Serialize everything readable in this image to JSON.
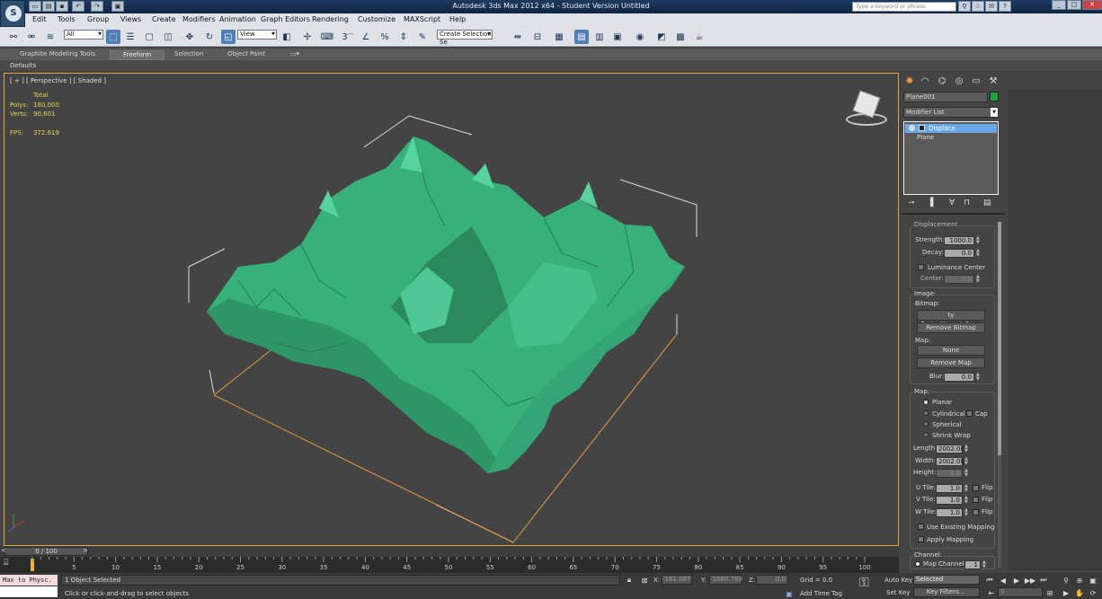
{
  "window": {
    "title": "Autodesk 3ds Max  2012 x64    -  Student Version   Untitled",
    "search_placeholder": "Type a keyword or phrase"
  },
  "menu": [
    "Edit",
    "Tools",
    "Group",
    "Views",
    "Create",
    "Modifiers",
    "Animation",
    "Graph Editors",
    "Rendering",
    "Customize",
    "MAXScript",
    "Help"
  ],
  "toolbar": {
    "selection_filter": "All",
    "ref_coord": "View",
    "named_selection": "Create Selection Se",
    "snap_label": "3"
  },
  "ribbon": {
    "tabs": [
      "Graphite Modeling Tools",
      "Freeform",
      "Selection",
      "Object Paint"
    ],
    "active": "Freeform",
    "sub_tab": "Defaults"
  },
  "viewport": {
    "label": "[ + ] [ Perspective ] [ Shaded ]",
    "stats": {
      "total_label": "Total",
      "polys_label": "Polys:",
      "polys": "180,000",
      "verts_label": "Verts:",
      "verts": "90,601",
      "fps_label": "FPS:",
      "fps": "372.619"
    },
    "colors": {
      "terrain": "#3ab57a",
      "selection": "#e89a3a"
    }
  },
  "panel": {
    "object_name": "Plane001",
    "object_color": "#1fa33b",
    "modifier_list": "Modifier List",
    "stack": [
      "Displace",
      "Plane"
    ],
    "displacement": {
      "header": "Displacement",
      "strength_label": "Strength:",
      "strength": "1000.0",
      "decay_label": "Decay:",
      "decay": "0.0",
      "luminance_label": "Luminance Center",
      "center_label": "Center:",
      "center": "0.5"
    },
    "image": {
      "header": "Image:",
      "bitmap_label": "Bitmap:",
      "bitmap": "ty Project\\terrain2.jpg",
      "remove_bitmap": "Remove Bitmap",
      "map_label": "Map:",
      "map_value": "None",
      "remove_map": "Remove Map",
      "blur_label": "Blur:",
      "blur": "0.0"
    },
    "map": {
      "header": "Map:",
      "planar": "Planar",
      "cylindrical": "Cylindrical",
      "cap": "Cap",
      "spherical": "Spherical",
      "shrink_wrap": "Shrink Wrap",
      "length_label": "Length:",
      "length": "2002.00",
      "width_label": "Width:",
      "width": "2002.00",
      "height_label": "Height:",
      "height": "1.0",
      "utile_label": "U Tile:",
      "utile": "1.0",
      "vtile_label": "V Tile:",
      "vtile": "1.0",
      "wtile_label": "W Tile:",
      "wtile": "1.0",
      "flip": "Flip",
      "use_existing": "Use Existing Mapping",
      "apply_mapping": "Apply Mapping"
    },
    "channel": {
      "header": "Channel:",
      "map_channel_label": "Map Channel:",
      "map_channel": "1"
    }
  },
  "timeline": {
    "frame": "0 / 100",
    "ticks": [
      "0",
      "5",
      "10",
      "15",
      "20",
      "25",
      "30",
      "35",
      "40",
      "45",
      "50",
      "55",
      "60",
      "65",
      "70",
      "75",
      "80",
      "85",
      "90",
      "95",
      "100"
    ]
  },
  "status": {
    "script_listener": "Max to Physc.",
    "selected": "1 Object Selected",
    "hint": "Click or click-and-drag to select objects",
    "x_label": "X:",
    "x": "-161.087",
    "y_label": "Y:",
    "y": "-1680.789",
    "z_label": "Z:",
    "z": "0.0",
    "grid": "Grid = 0.0",
    "add_time_tag": "Add Time Tag",
    "auto_key": "Auto Key",
    "set_key": "Set Key",
    "key_mode": "Selected",
    "key_filters": "Key Filters...",
    "frame_field": "0"
  }
}
